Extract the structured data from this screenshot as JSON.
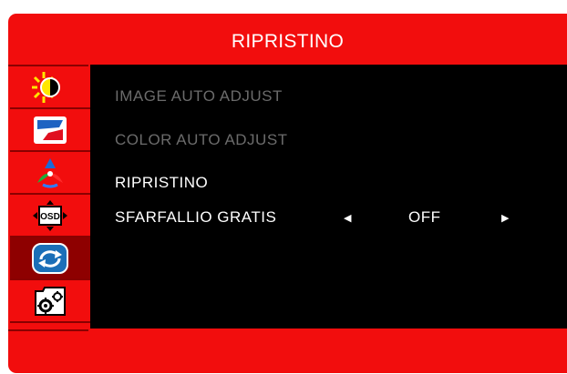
{
  "window": {
    "title": "RIPRISTINO"
  },
  "sidebar": {
    "items": [
      {
        "icon": "brightness-contrast-icon",
        "selected": false
      },
      {
        "icon": "image-flag-icon",
        "selected": false
      },
      {
        "icon": "color-rgb-icon",
        "selected": false
      },
      {
        "icon": "osd-icon",
        "selected": false
      },
      {
        "icon": "reset-refresh-icon",
        "selected": true
      },
      {
        "icon": "settings-gears-icon",
        "selected": false
      }
    ]
  },
  "menu": {
    "items": [
      {
        "label": "IMAGE  AUTO  ADJUST",
        "enabled": false
      },
      {
        "label": "COLOR  AUTO  ADJUST",
        "enabled": false
      },
      {
        "label": "RIPRISTINO",
        "enabled": true
      },
      {
        "label": "SFARFALLIO GRATIS",
        "enabled": true,
        "value": "OFF"
      }
    ]
  },
  "colors": {
    "frame": "#f20d0d",
    "panel": "#000000",
    "selected": "#8e0000",
    "text": "#ffffff",
    "disabled": "#6b6b6b"
  }
}
